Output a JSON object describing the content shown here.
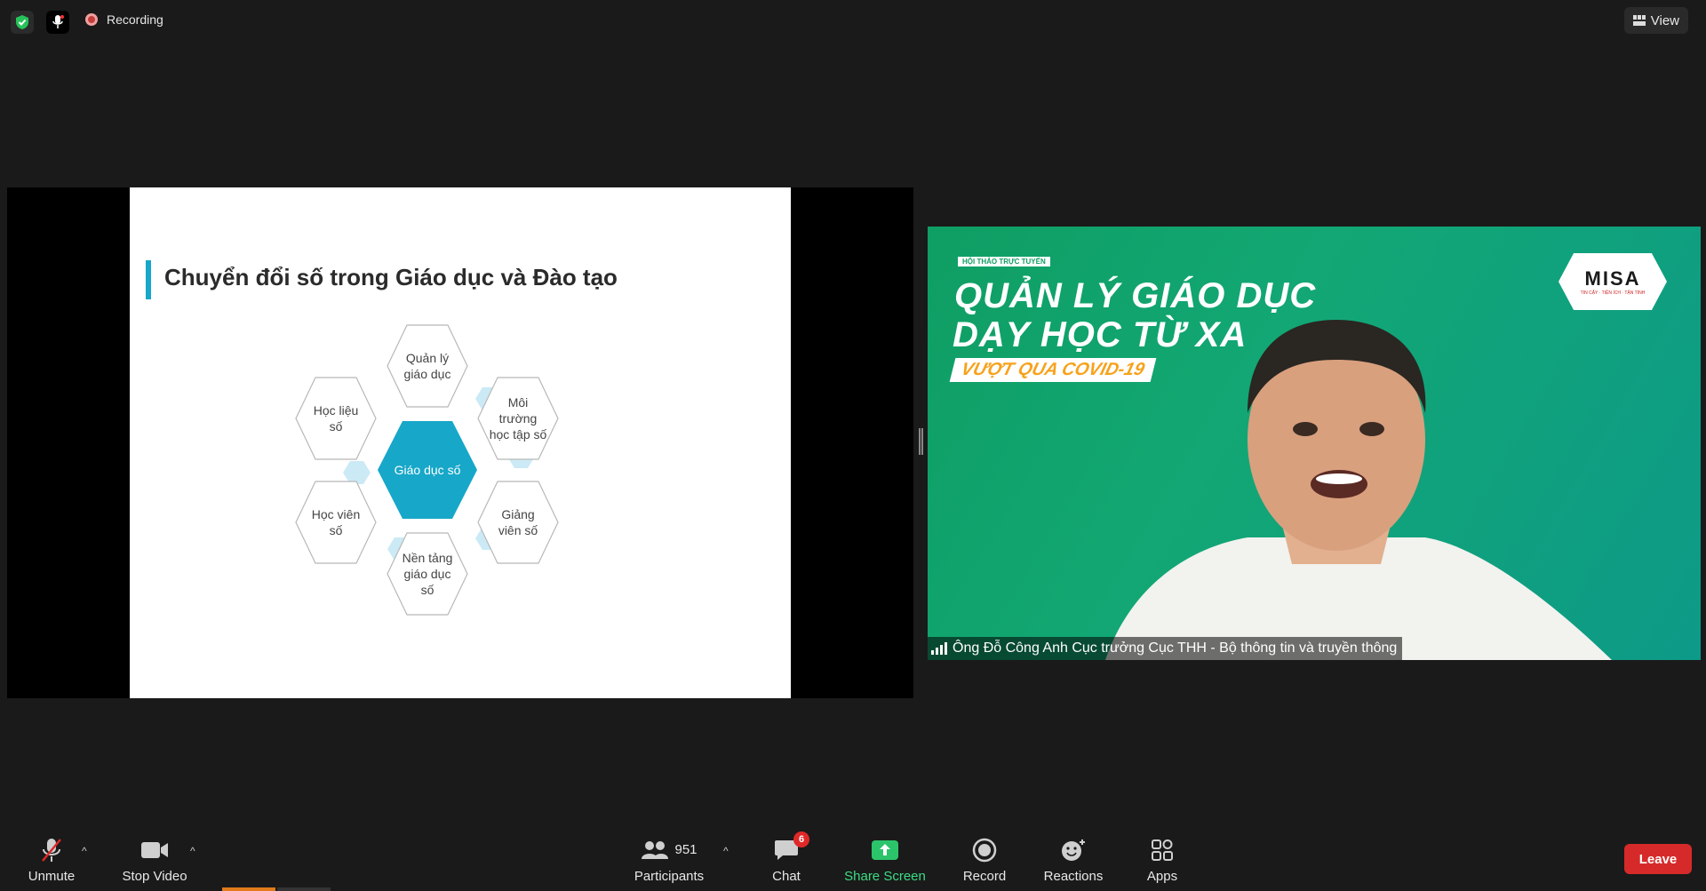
{
  "topbar": {
    "recording_label": "Recording",
    "view_label": "View"
  },
  "slide": {
    "title": "Chuyển đổi số trong Giáo dục và Đào tạo",
    "center": "Giáo dục số",
    "nodes": [
      {
        "lines": [
          "Quản lý",
          "giáo dục"
        ]
      },
      {
        "lines": [
          "Học liệu",
          "số"
        ]
      },
      {
        "lines": [
          "Môi",
          "trường",
          "học tập số"
        ]
      },
      {
        "lines": [
          "Học viên",
          "số"
        ]
      },
      {
        "lines": [
          "Giảng",
          "viên số"
        ]
      },
      {
        "lines": [
          "Nền tảng",
          "giáo dục",
          "số"
        ]
      }
    ],
    "accent_color": "#17a7c9"
  },
  "video": {
    "tag": "HỘI THẢO TRỰC TUYẾN",
    "title_line1": "QUẢN LÝ GIÁO DỤC",
    "title_line2": "DẠY HỌC TỪ XA",
    "subtitle": "VƯỢT QUA COVID-19",
    "logo": "MISA",
    "logo_sub": "TIN CẬY · TIỆN ÍCH · TẬN TÌNH",
    "caption": "Ông Đỗ Công Anh Cục trưởng Cục THH - Bộ thông tin và truyền thông"
  },
  "toolbar": {
    "unmute": "Unmute",
    "stop_video": "Stop Video",
    "participants": "Participants",
    "participants_count": "951",
    "chat": "Chat",
    "chat_badge": "6",
    "share_screen": "Share Screen",
    "record": "Record",
    "reactions": "Reactions",
    "apps": "Apps",
    "leave": "Leave"
  }
}
